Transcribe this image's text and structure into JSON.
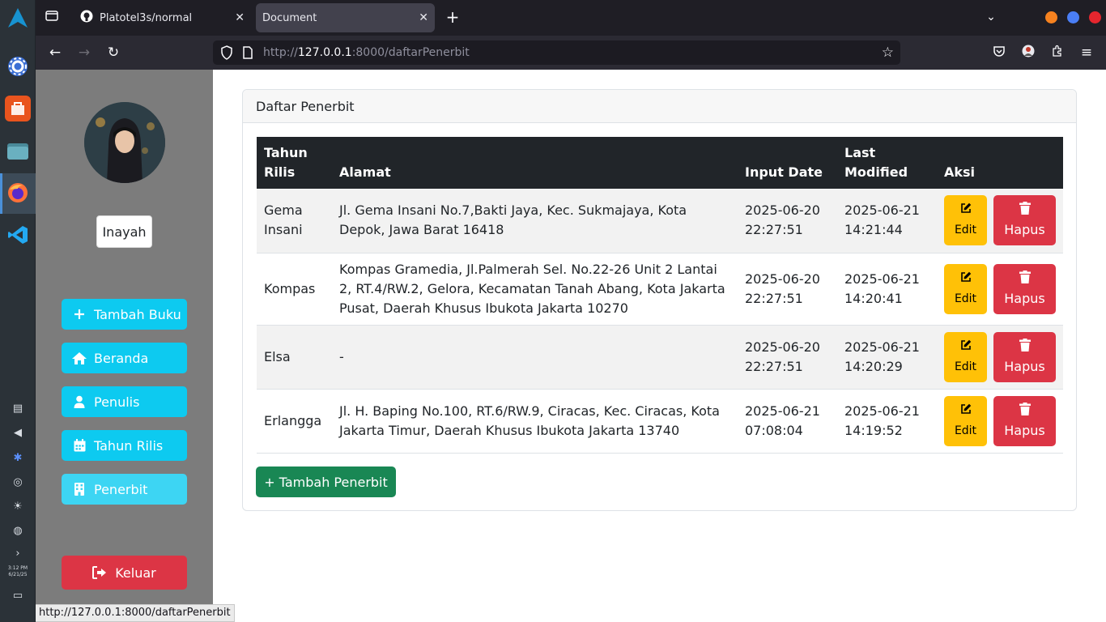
{
  "browser": {
    "tabs": [
      {
        "title": "Platotel3s/normal"
      },
      {
        "title": "Document"
      }
    ],
    "url_prefix": "http://",
    "url_host": "127.0.0.1",
    "url_path": ":8000/daftarPenerbit",
    "status_url": "http://127.0.0.1:8000/daftarPenerbit"
  },
  "dock": {
    "clock_time": "3:12 PM",
    "clock_date": "6/21/25"
  },
  "sidebar": {
    "username": "Inayah",
    "items": [
      {
        "label": "Tambah Buku",
        "icon": "plus-icon"
      },
      {
        "label": "Beranda",
        "icon": "home-icon"
      },
      {
        "label": "Penulis",
        "icon": "user-icon"
      },
      {
        "label": "Tahun Rilis",
        "icon": "calendar-icon"
      },
      {
        "label": "Penerbit",
        "icon": "building-icon"
      }
    ],
    "logout_label": "Keluar"
  },
  "card": {
    "title": "Daftar Penerbit",
    "table": {
      "headers": [
        "Tahun Rilis",
        "Alamat",
        "Input Date",
        "Last Modified",
        "Aksi"
      ],
      "rows": [
        {
          "name": "Gema Insani",
          "alamat": "Jl. Gema Insani No.7,Bakti Jaya, Kec. Sukmajaya, Kota Depok, Jawa Barat 16418",
          "input_date": "2025-06-20 22:27:51",
          "last_modified": "2025-06-21 14:21:44"
        },
        {
          "name": "Kompas",
          "alamat": "Kompas Gramedia, Jl.Palmerah Sel. No.22-26 Unit 2 Lantai 2, RT.4/RW.2, Gelora, Kecamatan Tanah Abang, Kota Jakarta Pusat, Daerah Khusus Ibukota Jakarta 10270",
          "input_date": "2025-06-20 22:27:51",
          "last_modified": "2025-06-21 14:20:41"
        },
        {
          "name": "Elsa",
          "alamat": "-",
          "input_date": "2025-06-20 22:27:51",
          "last_modified": "2025-06-21 14:20:29"
        },
        {
          "name": "Erlangga",
          "alamat": "Jl. H. Baping No.100, RT.6/RW.9, Ciracas, Kec. Ciracas, Kota Jakarta Timur, Daerah Khusus Ibukota Jakarta 13740",
          "input_date": "2025-06-21 07:08:04",
          "last_modified": "2025-06-21 14:19:52"
        }
      ],
      "edit_label": "Edit",
      "delete_label": "Hapus"
    },
    "add_label": "+ Tambah Penerbit"
  },
  "colors": {
    "info": "#0dcaf0",
    "danger": "#dc3545",
    "warning": "#ffc107",
    "success": "#198754",
    "table_header": "#212529"
  }
}
